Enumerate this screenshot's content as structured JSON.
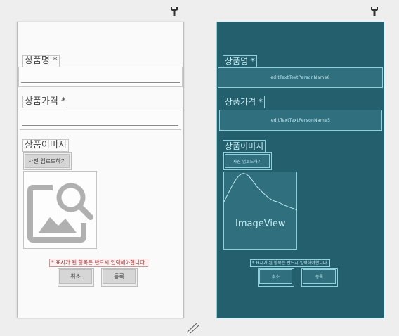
{
  "design": {
    "product_name_label": "상품명 *",
    "product_price_label": "상품가격 *",
    "product_image_label": "상품이미지",
    "upload_button_label": "사진 업로드하기",
    "required_notice": "* 표시가 된 항목은 반드시 입력해야합니다.",
    "cancel_label": "취소",
    "register_label": "등록",
    "image_icon": "image-placeholder-icon"
  },
  "blueprint": {
    "product_name_label": "상품명 *",
    "product_price_label": "상품가격 *",
    "product_image_label": "상품이미지",
    "name_field_id": "editTextTextPersonName6",
    "price_field_id": "editTextTextPersonName5",
    "upload_button_label": "사진 업로드하기",
    "image_view_label": "ImageView",
    "required_notice": "* 표시가 된 항목은 반드시 입력해야합니다.",
    "cancel_label": "취소",
    "register_label": "등록"
  },
  "colors": {
    "blueprint_bg": "#245f6e",
    "blueprint_line": "#8fd0dc",
    "warning_text": "#b03030"
  },
  "icons": [
    "wrench-icon",
    "resize-handle-icon"
  ]
}
